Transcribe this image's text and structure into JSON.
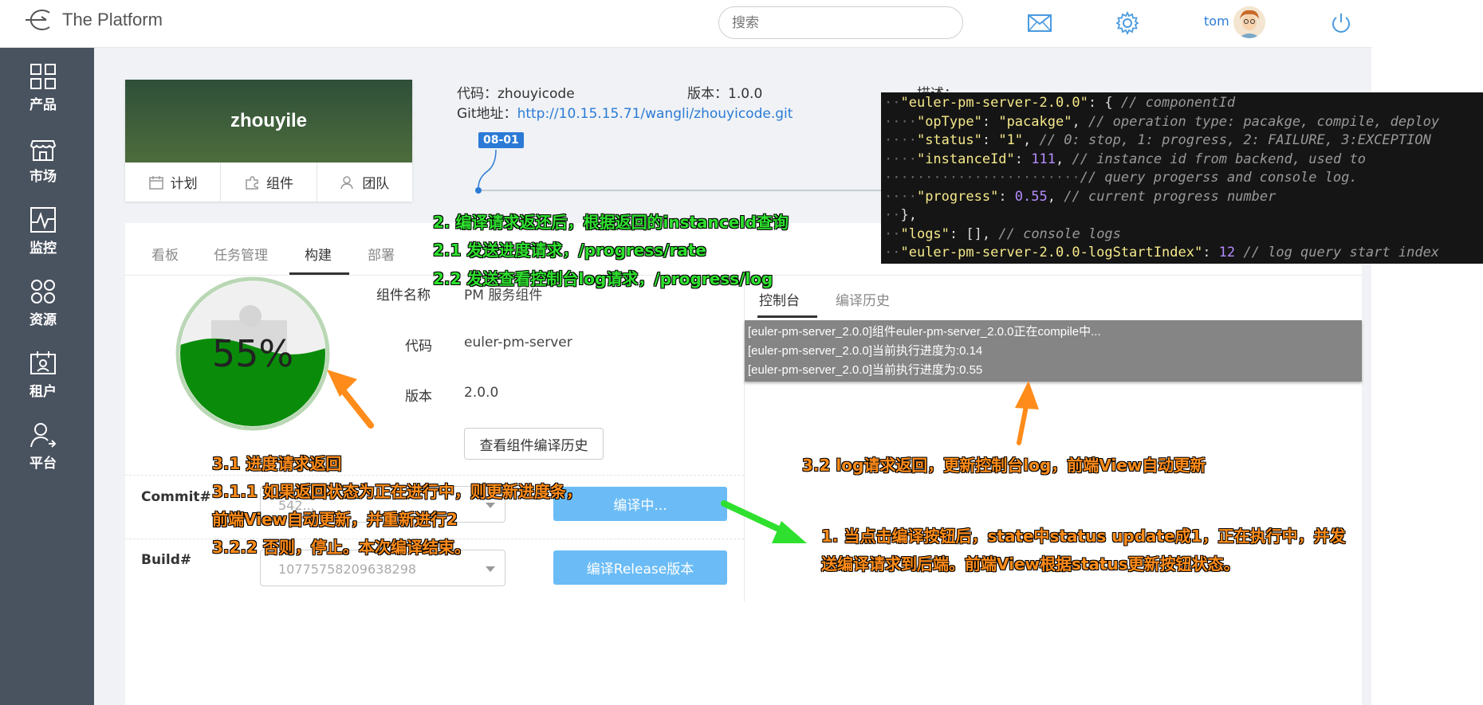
{
  "header": {
    "app_title": "The Platform",
    "search_placeholder": "搜索",
    "username": "tom"
  },
  "sidebar": {
    "items": [
      {
        "label": "产品",
        "icon": "grid-icon"
      },
      {
        "label": "市场",
        "icon": "store-icon"
      },
      {
        "label": "监控",
        "icon": "monitor-chart-icon"
      },
      {
        "label": "资源",
        "icon": "resources-icon"
      },
      {
        "label": "租户",
        "icon": "tenant-icon"
      },
      {
        "label": "平台",
        "icon": "platform-user-icon"
      }
    ]
  },
  "project": {
    "name": "zhouyile",
    "tabs": [
      "计划",
      "组件",
      "团队"
    ],
    "code_label": "代码：",
    "code_value": "zhouyicode",
    "version_label": "版本：",
    "version_value": "1.0.0",
    "git_label": "Git地址：",
    "git_url": "http://10.15.15.71/wangli/zhouyicode.git",
    "desc_label": "描述：",
    "timeline_tag": "08-01"
  },
  "main_tabs": [
    "看板",
    "任务管理",
    "构建",
    "部署"
  ],
  "active_main_tab": "构建",
  "component": {
    "name_label": "组件名称",
    "name_value": "PM 服务组件",
    "code_label": "代码",
    "code_value": "euler-pm-server",
    "version_label": "版本",
    "version_value": "2.0.0",
    "history_button": "查看组件编译历史",
    "progress_text": "55%",
    "progress": 0.55
  },
  "build": {
    "commit_label": "Commit#",
    "commit_value": "542...",
    "build_label": "Build#",
    "build_value": "10775758209638298",
    "compile_button": "编译中...",
    "release_button": "编译Release版本"
  },
  "console": {
    "tabs": [
      "控制台",
      "编译历史"
    ],
    "lines": [
      "[euler-pm-server_2.0.0]组件euler-pm-server_2.0.0正在compile中...",
      "[euler-pm-server_2.0.0]当前执行进度为:0.14",
      "[euler-pm-server_2.0.0]当前执行进度为:0.55"
    ]
  },
  "code_overlay": {
    "l1_key": "\"euler-pm-server-2.0.0\"",
    "l1_comment": "// componentId",
    "l2_key": "\"opType\"",
    "l2_val": "\"pacakge\"",
    "l2_comment": "// operation type: pacakge, compile, deploy",
    "l3_key": "\"status\"",
    "l3_val": "\"1\"",
    "l3_comment": "// 0: stop, 1: progress, 2: FAILURE, 3:EXCEPTION",
    "l4_key": "\"instanceId\"",
    "l4_val": "111",
    "l4_comment": "// instance id from backend, used to",
    "l5_comment": "// query progerss and console log.",
    "l6_key": "\"progress\"",
    "l6_val": "0.55",
    "l6_comment": "// current progress number",
    "l8_key": "\"logs\"",
    "l8_val": "[]",
    "l8_comment": "// console logs",
    "l9_key": "\"euler-pm-server-2.0.0-logStartIndex\"",
    "l9_val": "12",
    "l9_comment": "// log query start index"
  },
  "annotations": {
    "a2": "2. 编译请求返还后，根据返回的instanceId查询",
    "a21": "2.1 发送进度请求，/progress/rate",
    "a22": "2.2 发送查看控制台log请求，/progress/log",
    "a31": "3.1 进度请求返回",
    "a311": "3.1.1 如果返回状态为正在进行中，则更新进度条，",
    "a311b": "前端View自动更新，并重新进行2",
    "a322": "3.2.2 否则，停止。本次编译结束。",
    "a32": "3.2 log请求返回，更新控制台log，前端View自动更新",
    "a1": "1. 当点击编译按钮后，state中status update成1，正在执行中，并发",
    "a1b": "送编译请求到后端。前端View根据status更新按钮状态。"
  },
  "colors": {
    "sidebar": "#49525f",
    "accent_blue": "#2b7bd6",
    "button_blue": "#6bbcf6",
    "gauge_green": "#0a8c0a",
    "annotation_green": "#2fe02f",
    "annotation_orange": "#ff8c1a",
    "console_bg": "#858585"
  }
}
